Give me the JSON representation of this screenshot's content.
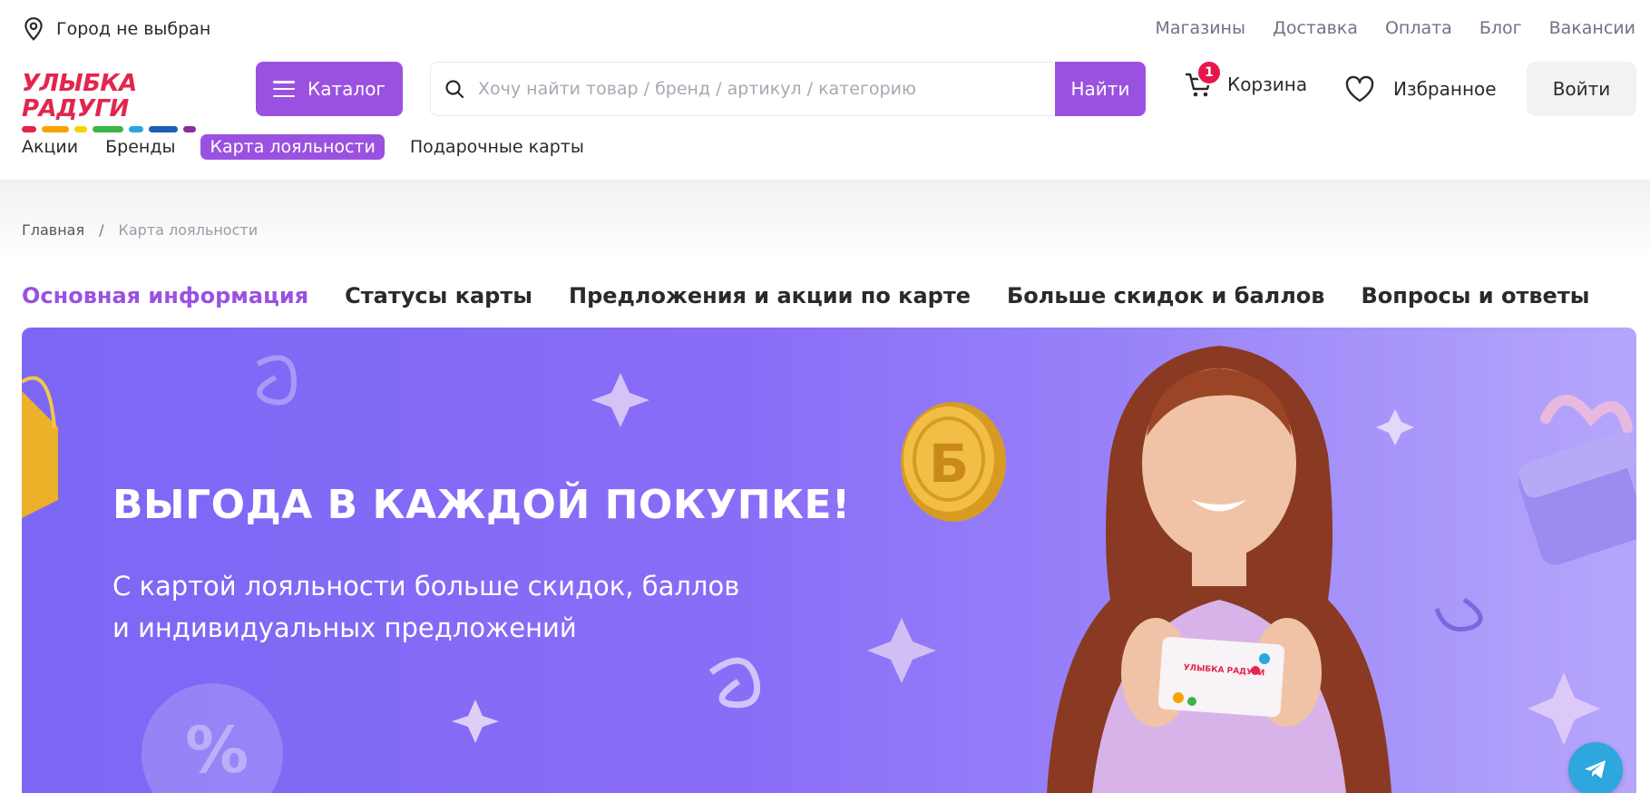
{
  "topbar": {
    "city": "Город не выбран",
    "links": [
      "Магазины",
      "Доставка",
      "Оплата",
      "Блог",
      "Вакансии"
    ]
  },
  "header": {
    "logo_text": "УЛЫБКА РАДУГИ",
    "logo_colors": [
      "#e2264d",
      "#f7a400",
      "#f6d300",
      "#3bb54a",
      "#2aa6de",
      "#1d5fb5",
      "#8a2d9e"
    ],
    "catalog_label": "Каталог",
    "search_placeholder": "Хочу найти товар / бренд / артикул / категорию",
    "search_button": "Найти",
    "cart_label": "Корзина",
    "cart_count": "1",
    "favorites_label": "Избранное",
    "login_label": "Войти"
  },
  "nav": {
    "items": [
      "Акции",
      "Бренды",
      "Карта лояльности",
      "Подарочные карты"
    ],
    "active_index": 2
  },
  "breadcrumb": {
    "home": "Главная",
    "separator": "/",
    "current": "Карта лояльности"
  },
  "tabs": {
    "items": [
      "Основная информация",
      "Статусы карты",
      "Предложения и акции по карте",
      "Больше скидок и баллов",
      "Вопросы и ответы"
    ],
    "active_index": 0
  },
  "banner": {
    "title": "ВЫГОДА В КАЖДОЙ ПОКУПКЕ!",
    "subtitle_line1": "С картой лояльности больше скидок, баллов",
    "subtitle_line2": "и индивидуальных предложений",
    "coin_letter": "Б",
    "card_brand": "УЛЫБКА РАДУГИ"
  },
  "colors": {
    "accent": "#9b51e0",
    "badge": "#e8174c",
    "banner_bg": "#7c67f5",
    "telegram": "#2ea6de"
  }
}
